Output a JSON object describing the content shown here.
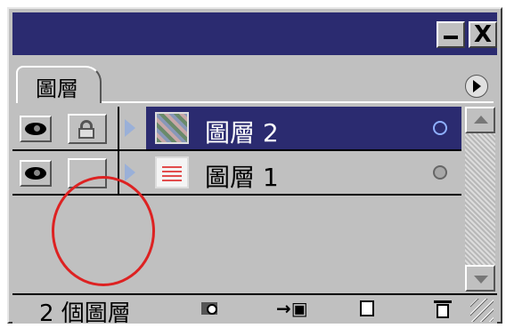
{
  "window": {
    "minimize_icon": "minimize-icon",
    "close_label": "X",
    "title_bar_color": "#2b2b70"
  },
  "tab": {
    "label": "圖層"
  },
  "layers": [
    {
      "name": "圖層 2",
      "selected": true,
      "visible": true,
      "locked": true
    },
    {
      "name": "圖層 1",
      "selected": false,
      "visible": true,
      "locked": false
    }
  ],
  "status": {
    "count_text": "2 個圖層"
  },
  "icons": {
    "eye": "eye-icon",
    "lock": "lock-icon",
    "mask": "mask-icon",
    "new_set": "new-set-icon",
    "new_layer": "new-layer-icon",
    "trash": "trash-icon",
    "menu": "panel-menu-icon"
  },
  "colors": {
    "selection": "#2b2b70",
    "annotation_circle": "#dd2222"
  }
}
